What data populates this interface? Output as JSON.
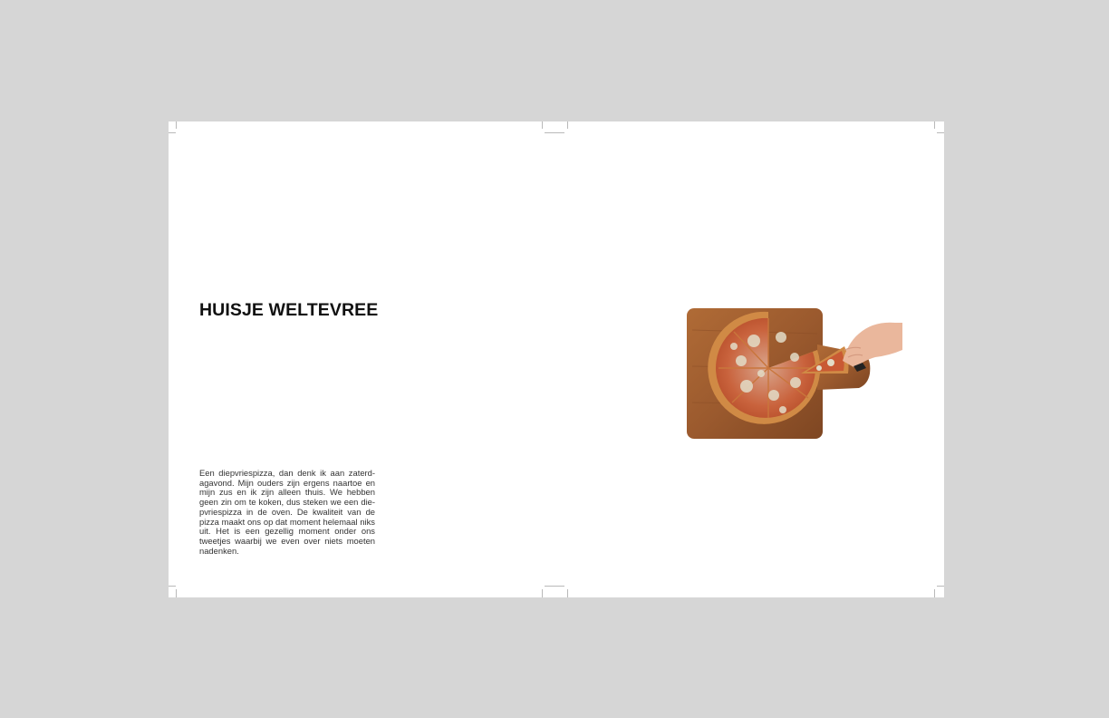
{
  "page": {
    "background_color": "#d6d6d6",
    "paper_color": "#ffffff"
  },
  "spread": {
    "left_page": {
      "title": "HUISJE WELTEVREE",
      "body_text": "Een diepvriespizza, dan denk ik aan zaterd­agavond. Mijn ouders zijn ergens naartoe en mijn zus en ik zijn alleen thuis. We hebben geen zin om te koken, dus steken we een die­pvriespizza in de oven. De kwaliteit van de piz­za maakt ons op dat moment helemaal niks uit. Het is een gezellig moment onder ons tweetjes waarbij we even over niets moeten nadenken."
    },
    "right_page": {
      "photo": {
        "subject_icon": "pizza-on-wooden-board-photo",
        "board_color": "#9b5a2e",
        "crust_color": "#d08a45",
        "sauce_color": "#c1452a",
        "cheese_color": "#d7d1bc"
      }
    }
  }
}
